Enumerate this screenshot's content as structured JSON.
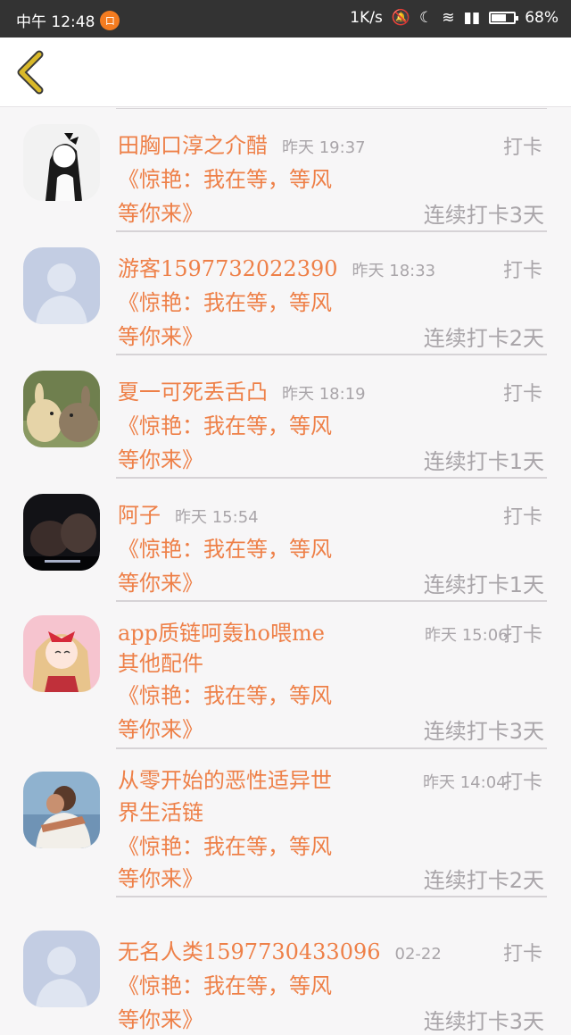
{
  "status_bar": {
    "left_text": "中午 12:48",
    "app_badge": "口",
    "speed": "1K/s",
    "battery_text": "68%",
    "battery_level": 0.68
  },
  "header": {
    "back_icon": "chevron-left-icon"
  },
  "colors": {
    "accent": "#ee8048",
    "muted": "#a9a5a9",
    "back_icon": "#d9b92a"
  },
  "feed": {
    "items": [
      {
        "name": "田胸口淳之介醋",
        "time": "昨天 19:37",
        "checkin": "打卡",
        "quote1": "《惊艳：我在等，等风",
        "quote2": "等你来》",
        "streak": "连续打卡3天",
        "avatar": "anime-girl-bw"
      },
      {
        "name": "游客15977320223​90",
        "time": "昨天 18:33",
        "checkin": "打卡",
        "quote1": "《惊艳：我在等，等风",
        "quote2": "等你来》",
        "streak": "连续打卡2天",
        "avatar": "default-user"
      },
      {
        "name": "夏一可死丢舌凸",
        "time": "昨天 18:19",
        "checkin": "打卡",
        "quote1": "《惊艳：我在等，等风",
        "quote2": "等你来》",
        "streak": "连续打卡1天",
        "avatar": "rabbits"
      },
      {
        "name": "阿子",
        "time": "昨天 15:54",
        "checkin": "打卡",
        "quote1": "《惊艳：我在等，等风",
        "quote2": "等你来》",
        "streak": "连续打卡1天",
        "avatar": "dark-photo"
      },
      {
        "name": "app质链呵轰ho喂me",
        "name2": "其他配件",
        "time": "昨天 15:06",
        "checkin": "打卡",
        "quote1": "《惊艳：我在等，等风",
        "quote2": "等你来》",
        "streak": "连续打卡3天",
        "avatar": "anime-girl-pink"
      },
      {
        "name": "从零开始的恶性适异世",
        "name2": "界生活链",
        "time": "昨天 14:04",
        "checkin": "打卡",
        "quote1": "《惊艳：我在等，等风",
        "quote2": "等你来》",
        "streak": "连续打卡2天",
        "avatar": "hug-photo"
      },
      {
        "name": "无名人类15977304330​96",
        "time": "02-22",
        "checkin": "打卡",
        "quote1": "《惊艳：我在等，等风",
        "quote2": "等你来》",
        "streak": "连续打卡3天",
        "avatar": "default-user"
      }
    ]
  }
}
